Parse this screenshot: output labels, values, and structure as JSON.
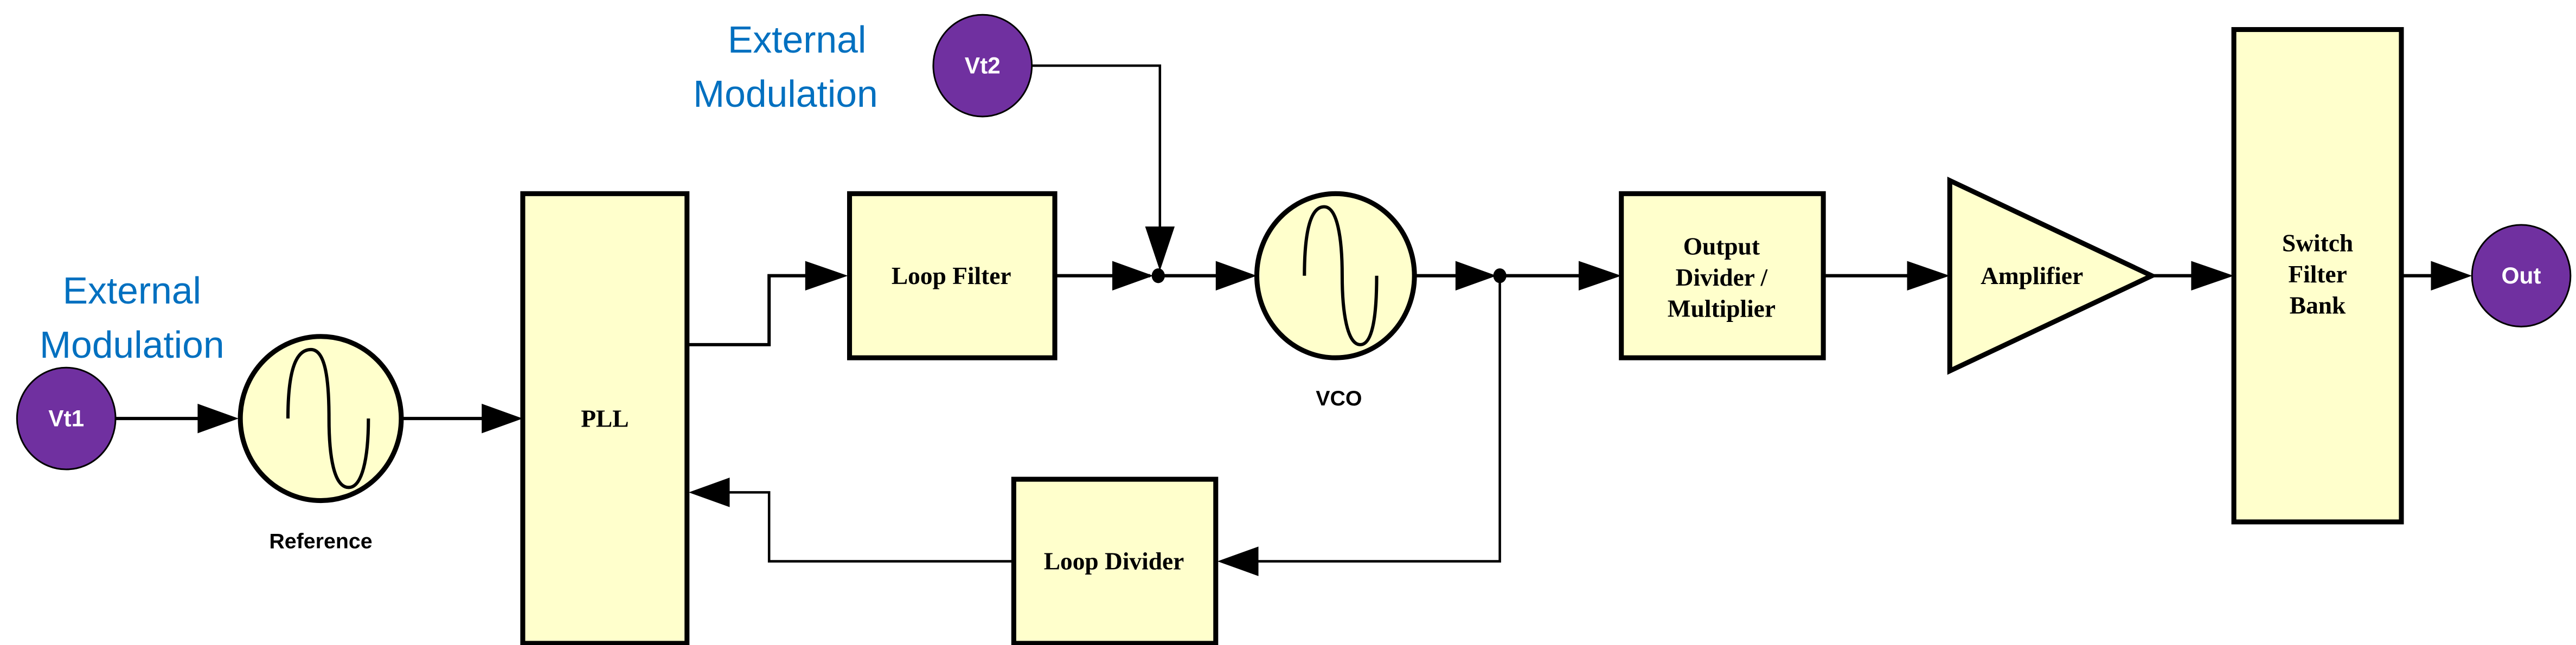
{
  "colors": {
    "block_fill": "#ffffcc",
    "port_fill": "#7030a0",
    "modulation_text": "#0070c0",
    "line": "#000000"
  },
  "modulation_labels": [
    {
      "line1": "External",
      "line2": "Modulation"
    },
    {
      "line1": "External",
      "line2": "Modulation"
    }
  ],
  "ports": {
    "vt1": "Vt1",
    "vt2": "Vt2",
    "out": "Out"
  },
  "oscillators": {
    "reference": "Reference",
    "vco": "VCO"
  },
  "blocks": {
    "pll": "PLL",
    "loop_filter": "Loop Filter",
    "loop_divider": "Loop Divider",
    "output_divider": [
      "Output",
      "Divider /",
      "Multiplier"
    ],
    "amplifier": "Amplifier",
    "switch_filter_bank": [
      "Switch",
      "Filter",
      "Bank"
    ]
  },
  "icons": {
    "oscillator": "sine-wave-icon",
    "amplifier": "triangle-amplifier-icon",
    "junction": "junction-dot-icon"
  }
}
